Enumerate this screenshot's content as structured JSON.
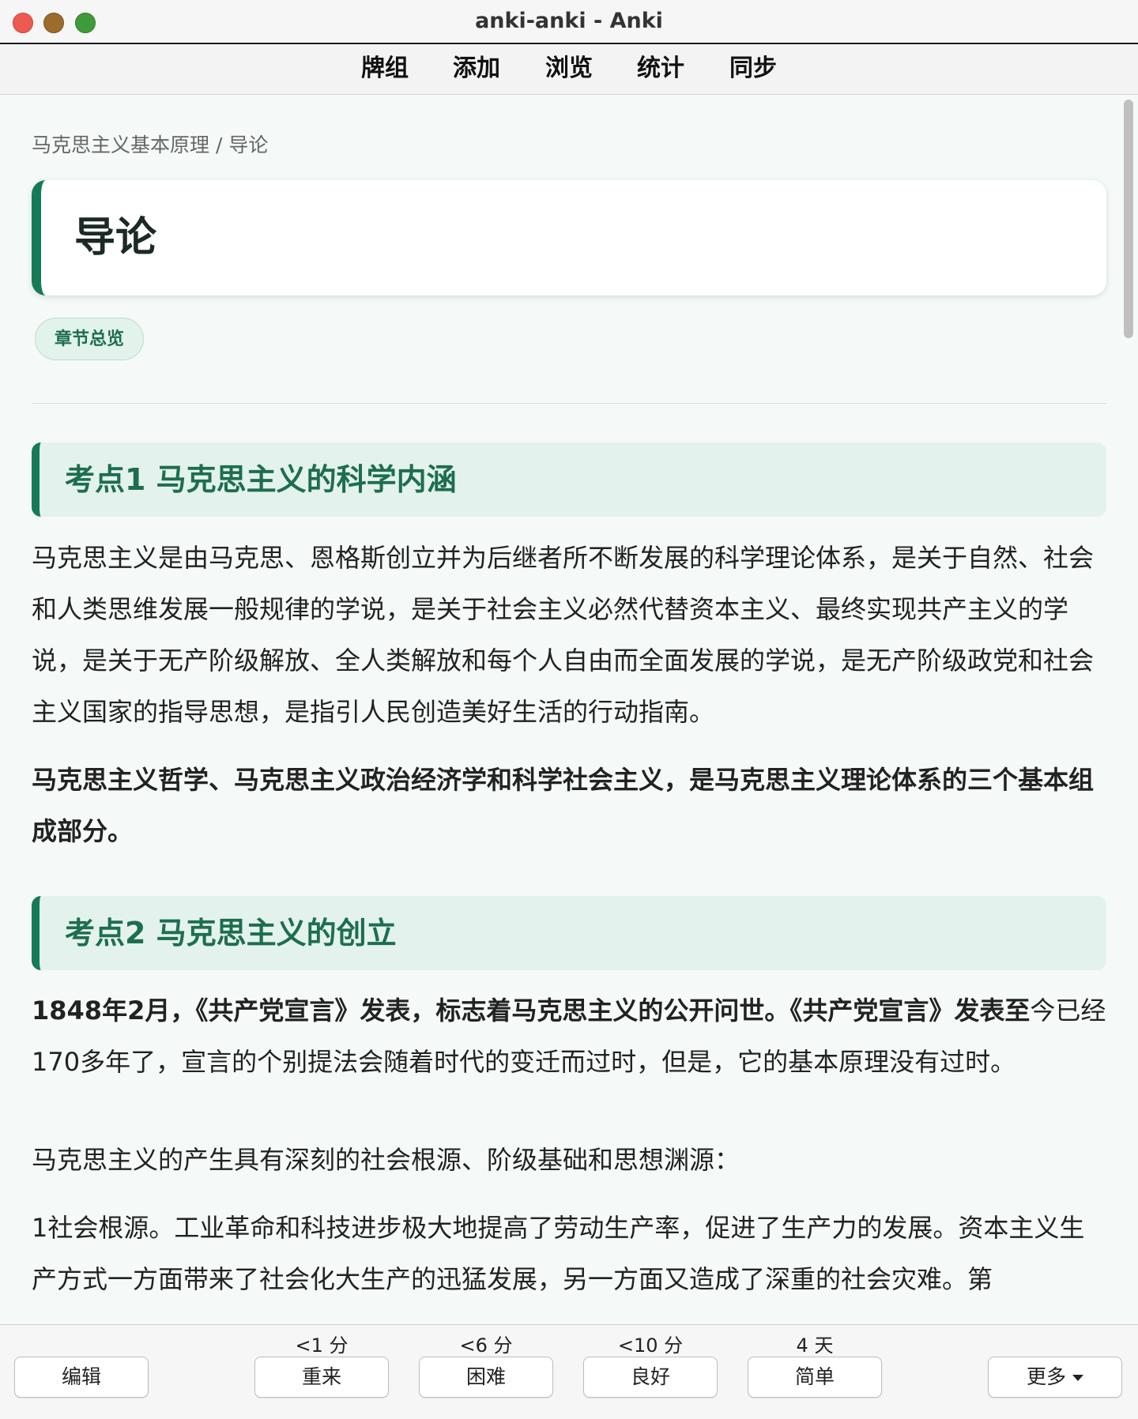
{
  "window": {
    "title": "anki-anki - Anki"
  },
  "toolbar": {
    "items": [
      "牌组",
      "添加",
      "浏览",
      "统计",
      "同步"
    ]
  },
  "card": {
    "breadcrumb": "马克思主义基本原理 / 导论",
    "title": "导论",
    "tag": "章节总览",
    "sections": [
      {
        "heading": "考点1 马克思主义的科学内涵"
      },
      {
        "heading": "考点2 马克思主义的创立"
      }
    ],
    "p1": "马克思主义是由马克思、恩格斯创立并为后继者所不断发展的科学理论体系，是关于自然、社会和人类思维发展一般规律的学说，是关于社会主义必然代替资本主义、最终实现共产主义的学说，是关于无产阶级解放、全人类解放和每个人自由而全面发展的学说，是无产阶级政党和社会主义国家的指导思想，是指引人民创造美好生活的行动指南。",
    "p2": "马克思主义哲学、马克思主义政治经济学和科学社会主义，是马克思主义理论体系的三个基本组成部分。",
    "p3_bold": "1848年2月，《共产党宣言》发表，标志着马克思主义的公开问世。《共产党宣言》发表至",
    "p3_rest": "今已经170多年了，宣言的个别提法会随着时代的变迁而过时，但是，它的基本原理没有过时。",
    "p4": "马克思主义的产生具有深刻的社会根源、阶级基础和思想渊源：",
    "p5": "1社会根源。工业革命和科技进步极大地提高了劳动生产率，促进了生产力的发展。资本主义生产方式一方面带来了社会化大生产的迅猛发展，另一方面又造成了深重的社会灾难。第"
  },
  "bottom": {
    "edit": "编辑",
    "more": "更多",
    "answers": [
      {
        "interval": "<1 分",
        "label": "重来"
      },
      {
        "interval": "<6 分",
        "label": "困难"
      },
      {
        "interval": "<10 分",
        "label": "良好"
      },
      {
        "interval": "4 天",
        "label": "简单"
      }
    ]
  }
}
